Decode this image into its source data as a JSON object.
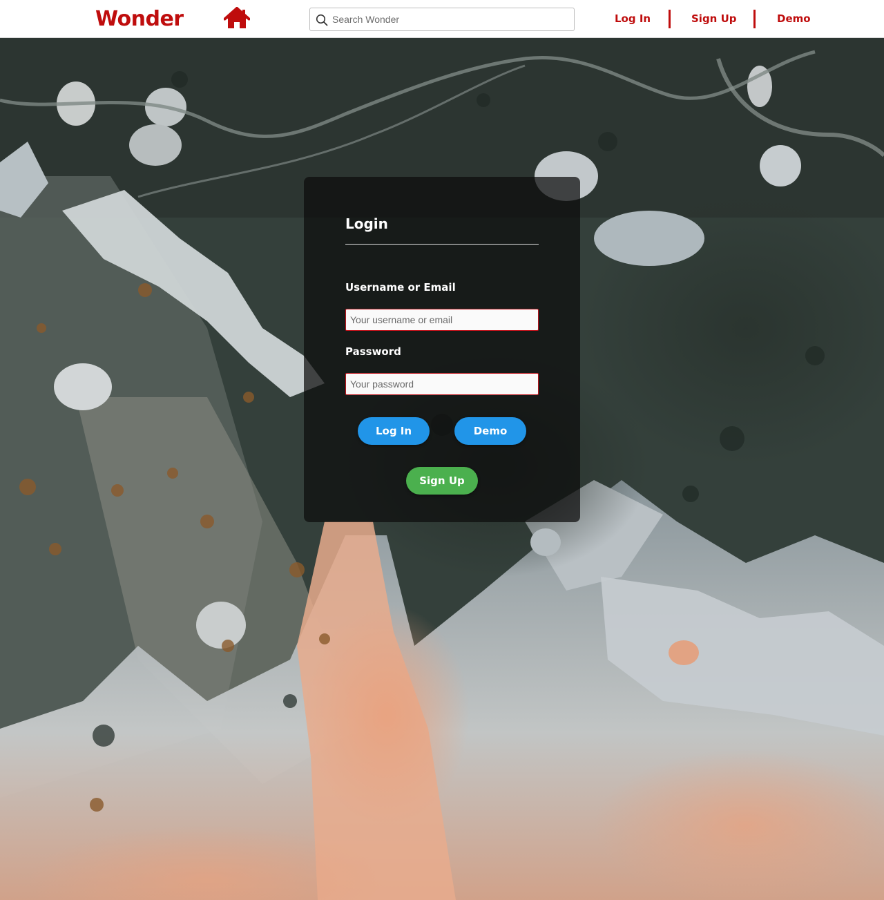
{
  "header": {
    "logo": "Wonder",
    "home_icon": "home-icon",
    "search": {
      "placeholder": "Search Wonder",
      "value": "",
      "icon": "search-icon"
    },
    "links": {
      "login": "Log In",
      "signup": "Sign Up",
      "demo": "Demo"
    }
  },
  "login_card": {
    "title": "Login",
    "username_label": "Username or Email",
    "username_placeholder": "Your username or email",
    "password_label": "Password",
    "password_placeholder": "Your password",
    "login_button": "Log In",
    "demo_button": "Demo",
    "signup_button": "Sign Up"
  },
  "colors": {
    "brand": "#bf0d0d",
    "login_button": "#2195e8",
    "demo_button": "#2195e8",
    "signup_button": "#4bb04e",
    "input_border": "#c0131b"
  }
}
